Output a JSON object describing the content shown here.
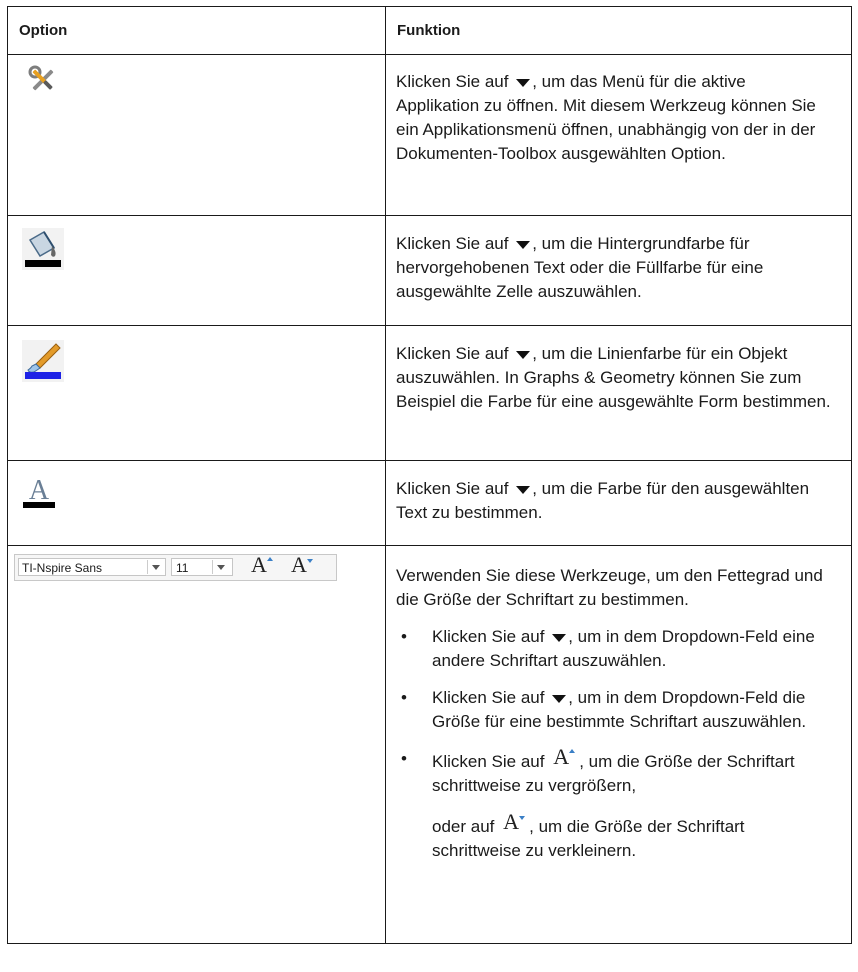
{
  "table": {
    "header": {
      "option": "Option",
      "function": "Funktion"
    },
    "rows": [
      {
        "icon": "tools-icon",
        "text": "Klicken Sie auf ▼, um das Menü für die aktive Applikation zu öffnen. Mit diesem Werkzeug können Sie ein Applikationsmenü öffnen, unabhängig von der in der Dokumenten-Toolbox ausgewählten Option.",
        "text_pre": "Klicken Sie auf",
        "text_post": ", um das Menü für die aktive Applikation zu öffnen. Mit diesem Werkzeug können Sie ein Applikationsmenü öffnen, unabhängig von der in der Dokumenten-Toolbox ausgewählten Option."
      },
      {
        "icon": "fill-color-bucket-icon",
        "text_pre": "Klicken Sie auf",
        "text_post": ", um die Hintergrundfarbe für hervorgehobenen Text oder die Füllfarbe für eine ausgewählte Zelle auszuwählen."
      },
      {
        "icon": "line-color-brush-icon",
        "text_pre": "Klicken Sie auf",
        "text_post": ", um die Linienfarbe für ein Objekt auszuwählen. In Graphs & Geometry können Sie zum Beispiel die Farbe für eine ausgewählte Form bestimmen."
      },
      {
        "icon": "text-color-icon",
        "text_pre": "Klicken Sie auf",
        "text_post": ", um die Farbe für den ausgewählten Text zu bestimmen."
      },
      {
        "icon": "font-toolbar",
        "toolbar": {
          "font_name": "TI-Nspire Sans",
          "font_size": "11"
        },
        "intro": "Verwenden Sie diese Werkzeuge, um den Fettegrad und die Größe der Schriftart zu bestimmen.",
        "bullet_symbol": "•",
        "bullets": [
          {
            "pre": "Klicken Sie auf",
            "post": ", um in dem Dropdown-Feld eine andere Schriftart auszuwählen."
          },
          {
            "pre": "Klicken Sie auf",
            "post": ", um in dem Dropdown-Feld die Größe für eine bestimmte Schriftart auszuwählen."
          },
          {
            "pre": "Klicken Sie auf",
            "mid": ", um die Größe der Schriftart schrittweise zu vergrößern,",
            "pre2": "oder auf",
            "post": ", um die Größe der Schriftart schrittweise zu verkleinern."
          }
        ]
      }
    ]
  },
  "colors": {
    "border": "#1a1a1a",
    "accent_blue": "#3a7fc6",
    "toolbar_bg": "#f6f6f6"
  }
}
